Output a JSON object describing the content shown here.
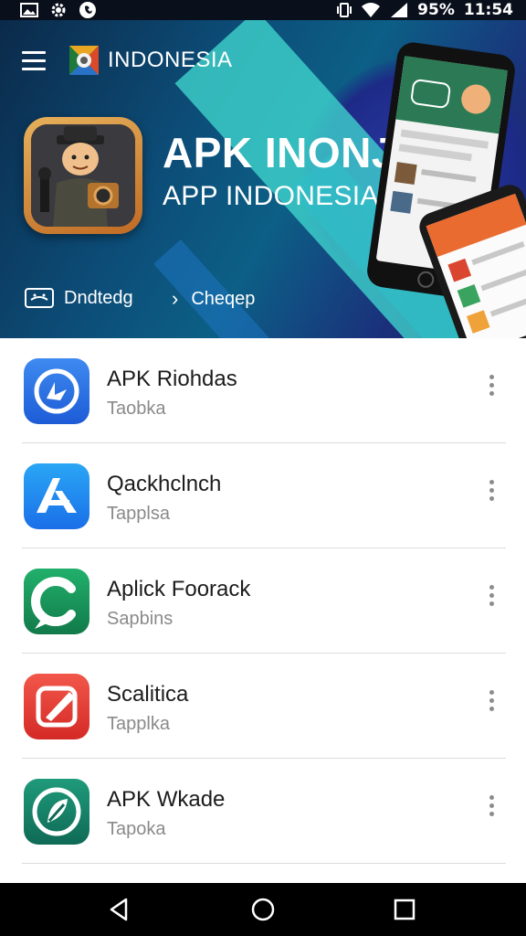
{
  "status_bar": {
    "battery_text": "95%",
    "time": "11:54"
  },
  "header": {
    "brand": "INDONESIA"
  },
  "hero": {
    "title": "APK INONJA",
    "subtitle": "APP INDONESIA"
  },
  "actions": {
    "left_label": "Dndtedg",
    "right_label": "Cheqep"
  },
  "apps": [
    {
      "name": "APK Riohdas",
      "sub": "Taobka",
      "icon": "blue-arrow-icon",
      "color": "#2a6fe0"
    },
    {
      "name": "Qackhclnch",
      "sub": "Tapplsa",
      "icon": "app-store-a-icon",
      "color": "#1d8af0"
    },
    {
      "name": "Aplick Foorack",
      "sub": "Sapbins",
      "icon": "green-c-icon",
      "color": "#1a9a5b"
    },
    {
      "name": "Scalitica",
      "sub": "Tapplka",
      "icon": "red-pencil-icon",
      "color": "#e8392f"
    },
    {
      "name": "APK Wkade",
      "sub": "Tapoka",
      "icon": "teal-leaf-icon",
      "color": "#17806a"
    }
  ]
}
